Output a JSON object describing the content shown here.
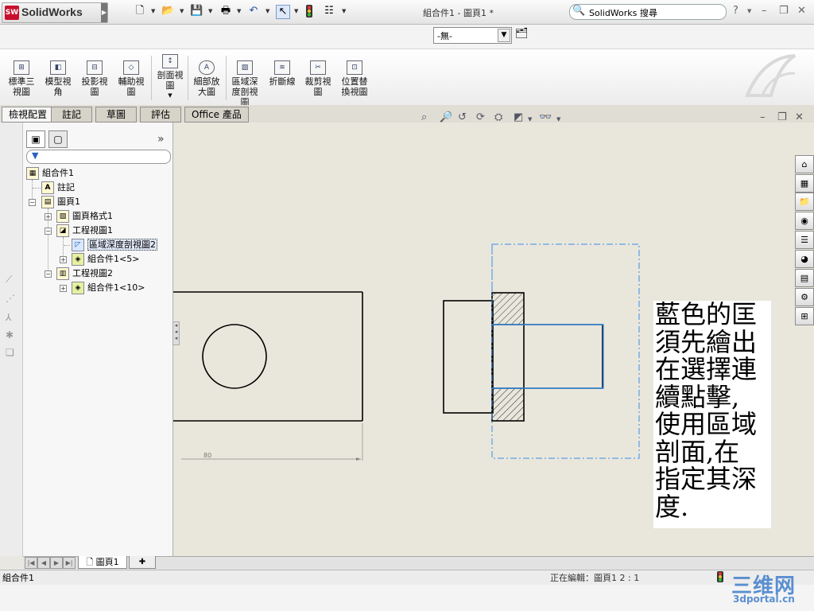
{
  "app": {
    "name": "SolidWorks",
    "logo_abbr": "SW",
    "document_title": "組合件1 - 圖頁1 *"
  },
  "search": {
    "text": "SolidWorks 搜尋"
  },
  "title_controls": {
    "help": "?",
    "minimize": "–",
    "restore": "❐",
    "close": "✕"
  },
  "layer": {
    "value": "-無-"
  },
  "commands": [
    {
      "label": "標準三\n視圖"
    },
    {
      "label": "模型視\n角"
    },
    {
      "label": "投影視\n圖"
    },
    {
      "label": "輔助視\n圖"
    },
    {
      "label": "剖面視\n圖"
    },
    {
      "label": "細部放\n大圖"
    },
    {
      "label": "區域深\n度剖視\n圖"
    },
    {
      "label": "折斷線"
    },
    {
      "label": "裁剪視\n圖"
    },
    {
      "label": "位置替\n換視圖"
    }
  ],
  "tabs": [
    "檢視配置",
    "註記",
    "草圖",
    "評估",
    "Office 產品"
  ],
  "tree": {
    "root": "組合件1",
    "annotations": "註記",
    "sheet": "圖頁1",
    "sheet_format": "圖頁格式1",
    "view1": "工程視圖1",
    "broken_out": "區域深度剖視圖2",
    "assy5": "組合件1<5>",
    "view2": "工程視圖2",
    "assy10": "組合件1<10>"
  },
  "drawing": {
    "dimension": "80"
  },
  "note": {
    "text": "藍色的匡\n須先繪出\n在選擇連\n續點擊,\n使用區域\n剖面,在\n指定其深\n度."
  },
  "sheet_tab": {
    "label": "圖頁1"
  },
  "status": {
    "left": "組合件1",
    "right": "正在編輯：圖頁1    2 : 1"
  },
  "watermark": {
    "big": "三维网",
    "small": "3dportal.cn"
  },
  "colors": {
    "selection_blue": "#3a8ee6",
    "background": "#e9e7dc"
  }
}
